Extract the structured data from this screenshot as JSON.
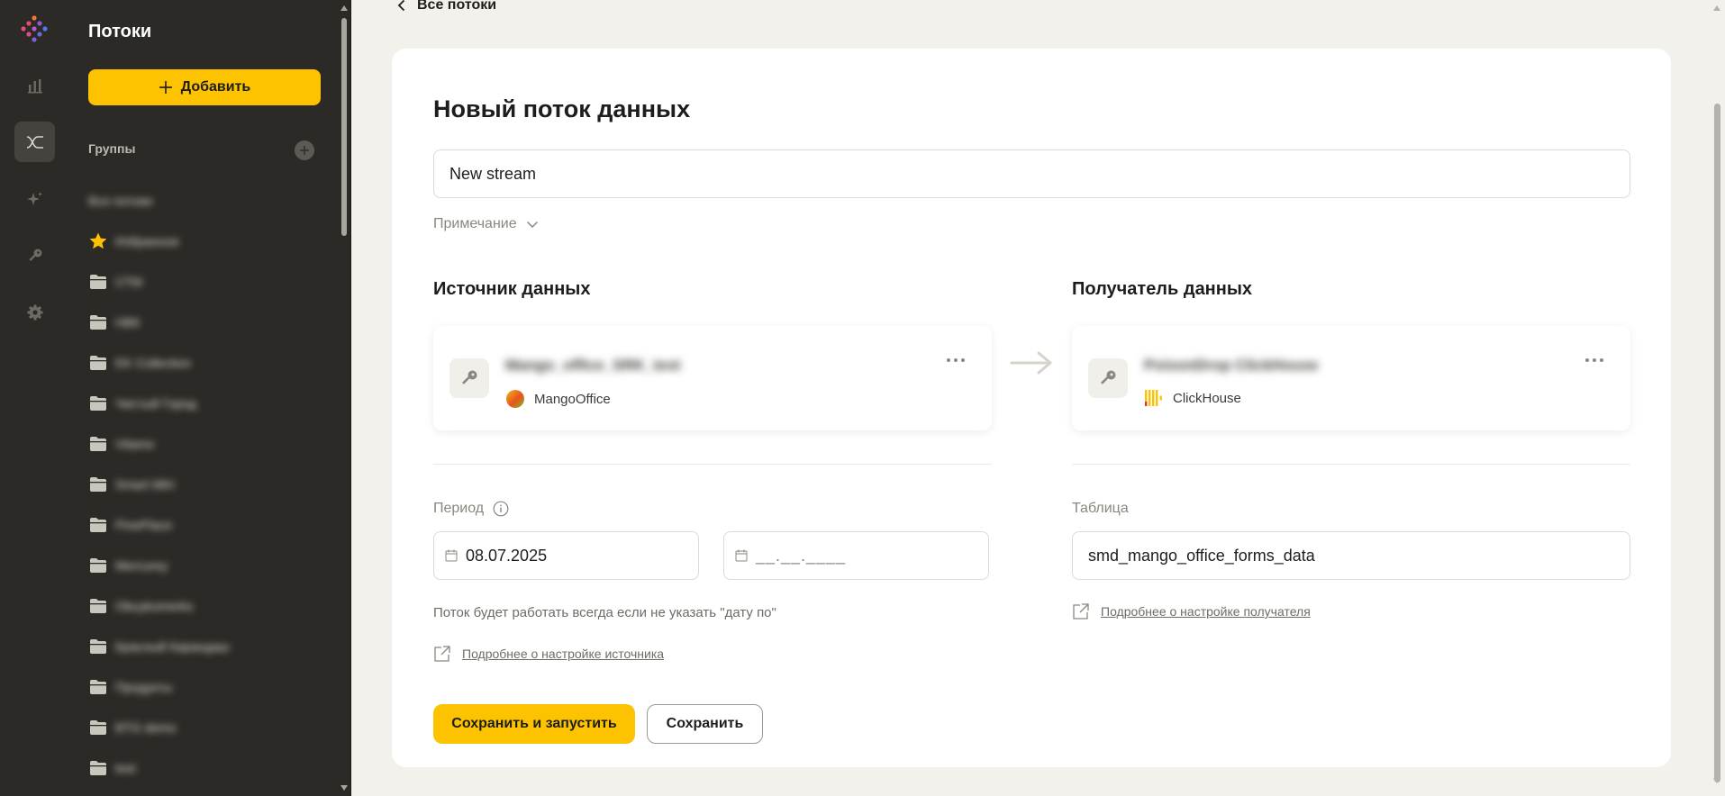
{
  "sidebar": {
    "title": "Потоки",
    "add_label": "Добавить",
    "groups_label": "Группы",
    "groups": [
      {
        "label": "Все потоки",
        "icon": "none"
      },
      {
        "label": "Избранное",
        "icon": "star-icon"
      },
      {
        "label": "СТМ",
        "icon": "folder-icon"
      },
      {
        "label": "НВК",
        "icon": "folder-icon"
      },
      {
        "label": "EK Collection",
        "icon": "folder-icon"
      },
      {
        "label": "Чистый Город",
        "icon": "folder-icon"
      },
      {
        "label": "Vitamo",
        "icon": "folder-icon"
      },
      {
        "label": "Smart MKI",
        "icon": "folder-icon"
      },
      {
        "label": "PinePlace",
        "icon": "folder-icon"
      },
      {
        "label": "Mercurey",
        "icon": "folder-icon"
      },
      {
        "label": "Obuykomerks",
        "icon": "folder-icon"
      },
      {
        "label": "Красный Карандаш",
        "icon": "folder-icon"
      },
      {
        "label": "Продукты",
        "icon": "folder-icon"
      },
      {
        "label": "BTG demo",
        "icon": "folder-icon"
      },
      {
        "label": "test",
        "icon": "folder-icon"
      }
    ]
  },
  "nav": {
    "back_label": "Все потоки"
  },
  "form": {
    "title": "Новый поток данных",
    "name_value": "New stream",
    "note_label": "Примечание",
    "source": {
      "section_title": "Источник данных",
      "name": "Mango_office_SRK_test",
      "type": "MangoOffice"
    },
    "destination": {
      "section_title": "Получатель данных",
      "name": "PoisonDrop ClickHouse",
      "type": "ClickHouse"
    },
    "period_label": "Период",
    "date_from": "08.07.2025",
    "date_to_placeholder": "__.__.____",
    "period_hint": "Поток будет работать всегда если не указать \"дату по\"",
    "source_doc_link": "Подробнее о настройке источника",
    "table_label": "Таблица",
    "table_value": "smd_mango_office_forms_data",
    "destination_doc_link": "Подробнее о настройке получателя",
    "save_run_label": "Сохранить и запустить",
    "save_label": "Сохранить"
  },
  "colors": {
    "accent": "#fdc300",
    "sidebar_bg": "#2b2a26",
    "page_bg": "#f3f1ec"
  }
}
